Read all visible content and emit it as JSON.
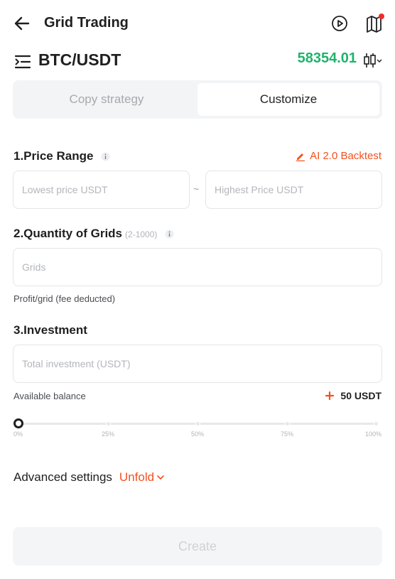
{
  "header": {
    "title": "Grid Trading",
    "icons": [
      "back-arrow-icon",
      "play-icon",
      "book-icon"
    ],
    "notification_color": "#f02a2a"
  },
  "pair": {
    "name": "BTC/USDT",
    "price": "58354.01",
    "price_color": "#20b26c"
  },
  "tabs": [
    {
      "label": "Copy strategy",
      "active": false
    },
    {
      "label": "Customize",
      "active": true
    }
  ],
  "price_range": {
    "title": "1.Price Range",
    "backtest_label": "AI 2.0 Backtest",
    "lowest_placeholder": "Lowest price USDT",
    "separator": "~",
    "highest_placeholder": "Highest Price USDT"
  },
  "grids": {
    "title": "2.Quantity of Grids",
    "range_hint": "(2-1000)",
    "placeholder": "Grids",
    "profit_label": "Profit/grid (fee deducted)"
  },
  "investment": {
    "title": "3.Investment",
    "placeholder": "Total investment (USDT)",
    "balance_label": "Available balance",
    "balance_value": "50 USDT",
    "slider_value_percent": 0,
    "slider_labels": [
      "0%",
      "25%",
      "50%",
      "75%",
      "100%"
    ]
  },
  "advanced": {
    "label": "Advanced settings",
    "toggle_label": "Unfold"
  },
  "create_label": "Create",
  "accent_color": "#f4511e"
}
